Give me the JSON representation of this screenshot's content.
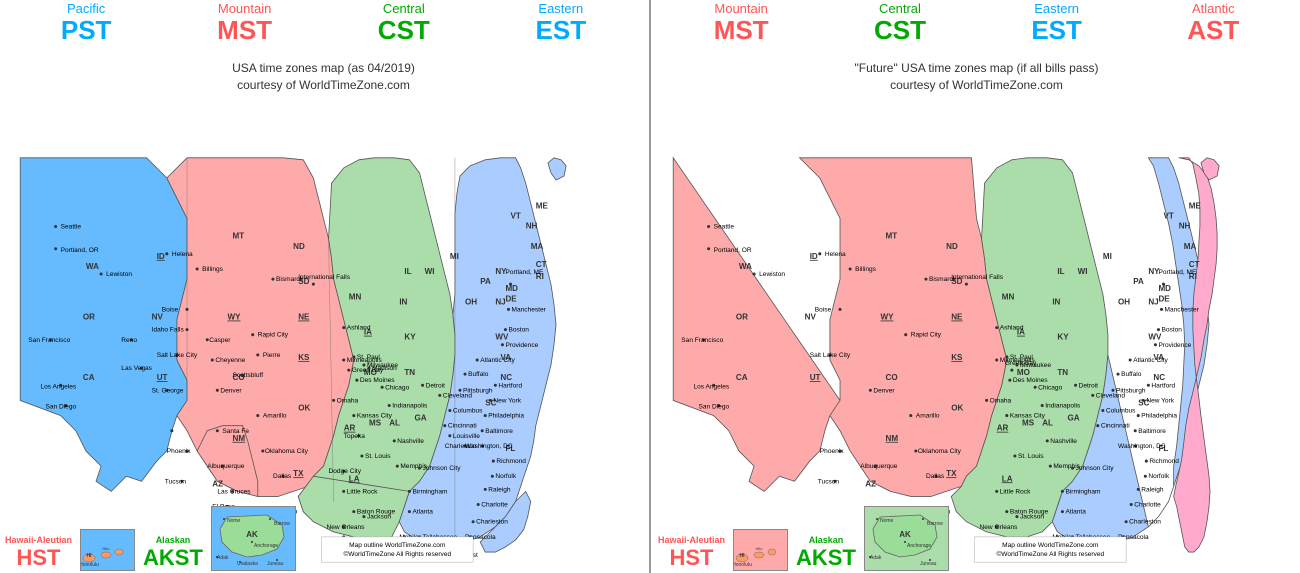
{
  "left_map": {
    "timezones": [
      {
        "id": "pacific",
        "name": "Pacific",
        "abbr": "PST",
        "color_name": "#00aaff",
        "color_abbr": "#00aaff"
      },
      {
        "id": "mountain",
        "name": "Mountain",
        "abbr": "MST",
        "color_name": "#ff5555",
        "color_abbr": "#ff5555"
      },
      {
        "id": "central",
        "name": "Central",
        "abbr": "CST",
        "color_name": "#00aa00",
        "color_abbr": "#00aa00"
      },
      {
        "id": "eastern",
        "name": "Eastern",
        "abbr": "EST",
        "color_name": "#00aaff",
        "color_abbr": "#00aaff"
      }
    ],
    "caption_line1": "USA time zones map (as 04/2019)",
    "caption_line2": "courtesy of WorldTimeZone.com",
    "hawaii_aleutian_label": "Hawaii-Aleutian",
    "hawaii_abbr": "HST",
    "alaskan_label": "Alaskan",
    "alaskan_abbr": "AKST"
  },
  "right_map": {
    "timezones": [
      {
        "id": "mountain",
        "name": "Mountain",
        "abbr": "MST",
        "color_name": "#ff5555",
        "color_abbr": "#ff5555"
      },
      {
        "id": "central",
        "name": "Central",
        "abbr": "CST",
        "color_name": "#00aa00",
        "color_abbr": "#00aa00"
      },
      {
        "id": "eastern",
        "name": "Eastern",
        "abbr": "EST",
        "color_name": "#00aaff",
        "color_abbr": "#00aaff"
      },
      {
        "id": "atlantic",
        "name": "Atlantic",
        "abbr": "AST",
        "color_name": "#ff5555",
        "color_abbr": "#ff5555"
      }
    ],
    "caption_line1": "\"Future\" USA time zones map (if all bills pass)",
    "caption_line2": "courtesy of WorldTimeZone.com",
    "hawaii_aleutian_label": "Hawaii-Aleutian",
    "hawaii_abbr": "HST",
    "alaskan_label": "Alaskan",
    "alaskan_abbr": "AKST"
  },
  "watermark": "Map outline WorldTimeZone.com\n©WorldTimeZone All Rights reserved"
}
